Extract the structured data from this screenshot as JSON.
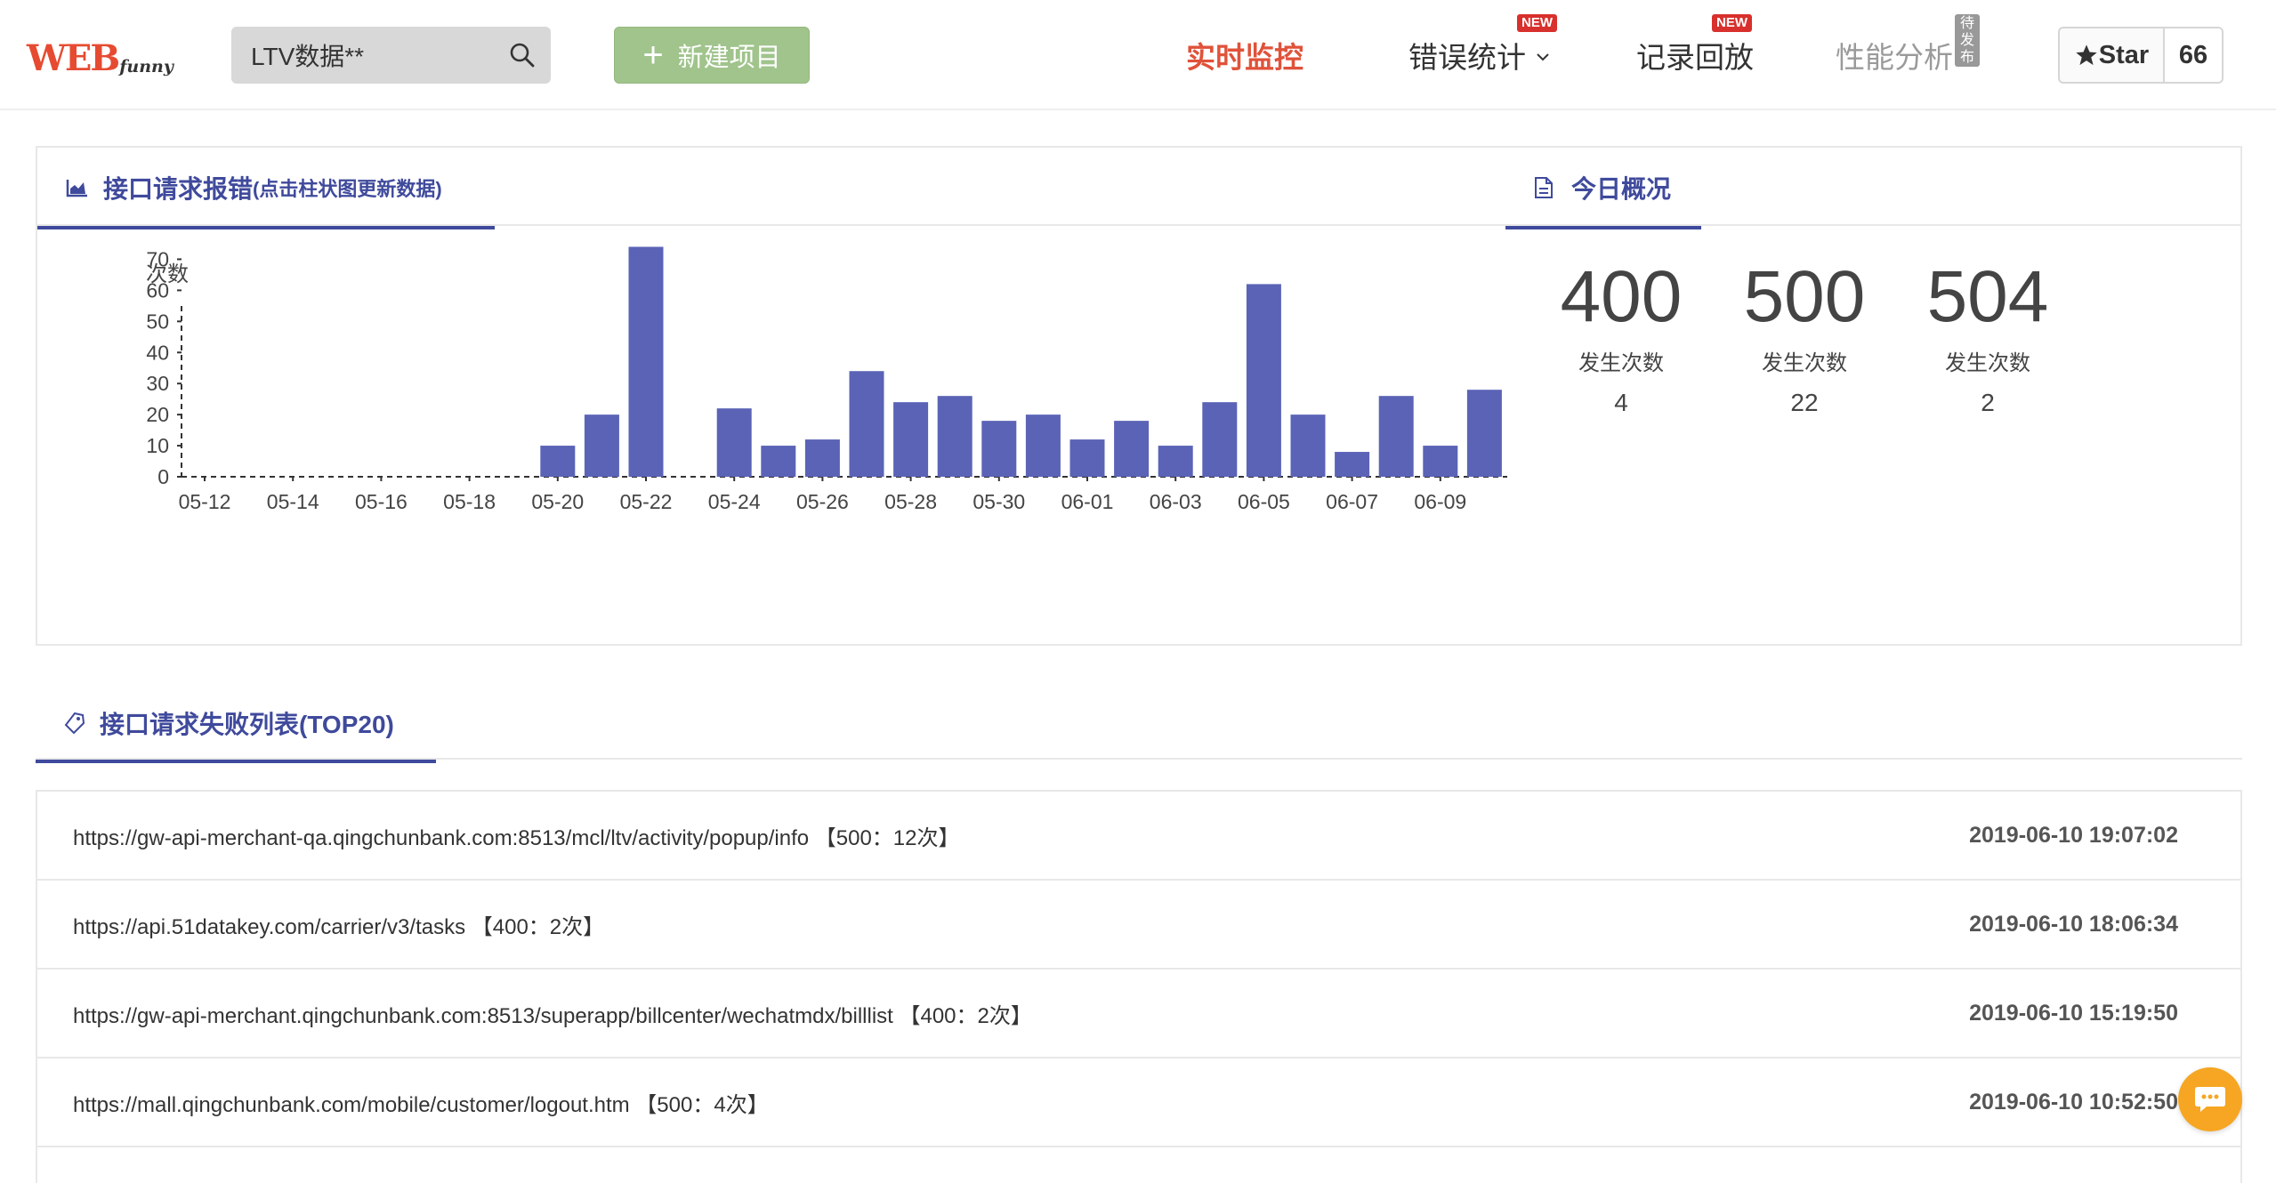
{
  "header": {
    "logo_main": "WEB",
    "logo_sub": "funny",
    "search_value": "LTV数据**",
    "new_project": "新建项目",
    "nav": [
      {
        "label": "实时监控"
      },
      {
        "label": "错误统计",
        "badge": "NEW"
      },
      {
        "label": "记录回放",
        "badge": "NEW"
      },
      {
        "label": "性能分析",
        "badge": "待发布"
      }
    ],
    "star_label": "Star",
    "star_count": "66"
  },
  "chart_panel": {
    "title": "接口请求报错",
    "subtitle": "(点击柱状图更新数据)"
  },
  "overview_panel": {
    "title": "今日概况",
    "items": [
      {
        "code": "400",
        "label": "发生次数",
        "count": "4"
      },
      {
        "code": "500",
        "label": "发生次数",
        "count": "22"
      },
      {
        "code": "504",
        "label": "发生次数",
        "count": "2"
      }
    ]
  },
  "chart_data": {
    "type": "bar",
    "ylabel": "次数",
    "ylim": [
      0,
      75
    ],
    "yticks": [
      0,
      10,
      20,
      30,
      40,
      50,
      60,
      70
    ],
    "categories": [
      "05-12",
      "05-13",
      "05-14",
      "05-15",
      "05-16",
      "05-17",
      "05-18",
      "05-19",
      "05-20",
      "05-21",
      "05-22",
      "05-23",
      "05-24",
      "05-25",
      "05-26",
      "05-27",
      "05-28",
      "05-29",
      "05-30",
      "05-31",
      "06-01",
      "06-02",
      "06-03",
      "06-04",
      "06-05",
      "06-06",
      "06-07",
      "06-08",
      "06-09",
      "06-10"
    ],
    "xtick_labels": [
      "05-12",
      "05-14",
      "05-16",
      "05-18",
      "05-20",
      "05-22",
      "05-24",
      "05-26",
      "05-28",
      "05-30",
      "06-01",
      "06-03",
      "06-05",
      "06-07",
      "06-09"
    ],
    "values": [
      0,
      0,
      0,
      0,
      0,
      0,
      0,
      0,
      10,
      20,
      74,
      0,
      22,
      10,
      12,
      34,
      24,
      26,
      18,
      20,
      12,
      18,
      10,
      24,
      62,
      20,
      8,
      26,
      10,
      28
    ],
    "bar_color": "#5b63b6"
  },
  "list": {
    "title": "接口请求失败列表(TOP20)",
    "rows": [
      {
        "url": "https://gw-api-merchant-qa.qingchunbank.com:8513/mcl/ltv/activity/popup/info 【500：12次】",
        "time": "2019-06-10 19:07:02"
      },
      {
        "url": "https://api.51datakey.com/carrier/v3/tasks 【400：2次】",
        "time": "2019-06-10 18:06:34"
      },
      {
        "url": "https://gw-api-merchant.qingchunbank.com:8513/superapp/billcenter/wechatmdx/billlist 【400：2次】",
        "time": "2019-06-10 15:19:50"
      },
      {
        "url": "https://mall.qingchunbank.com/mobile/customer/logout.htm 【500：4次】",
        "time": "2019-06-10 10:52:50"
      }
    ]
  },
  "colors": {
    "accent": "#3f4a9c",
    "active_nav": "#e0523a",
    "new_button": "#a0c48c",
    "bar": "#5b63b6"
  }
}
